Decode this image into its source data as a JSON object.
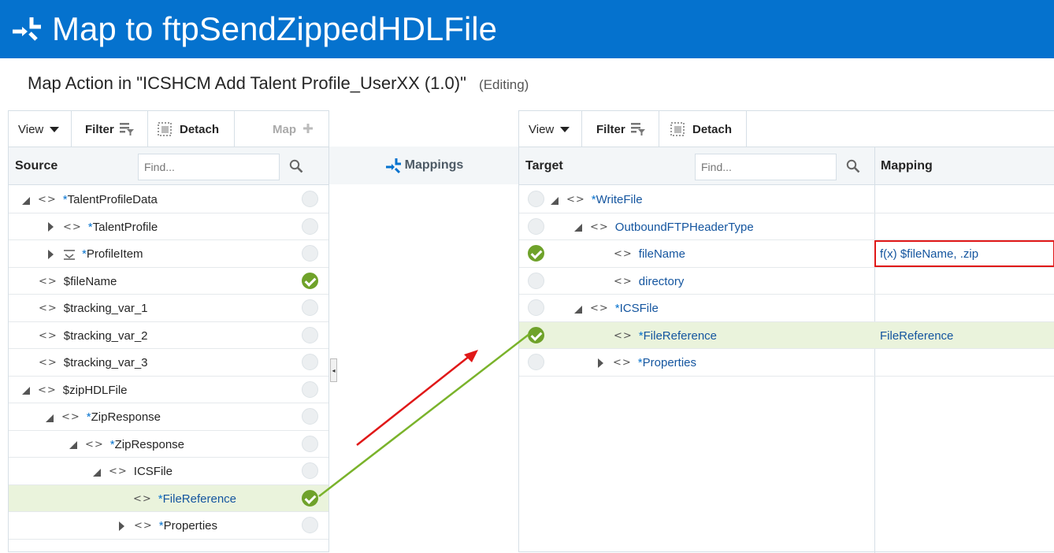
{
  "header": {
    "title": "Map to ftpSendZippedHDLFile",
    "icon": "map-merge-icon",
    "bg_color": "#0572ce"
  },
  "subheader": {
    "title": "Map Action in \"ICSHCM Add Talent Profile_UserXX (1.0)\"",
    "status": "(Editing)"
  },
  "source_panel": {
    "toolbar": {
      "view": "View",
      "filter": "Filter",
      "detach": "Detach",
      "map": "Map"
    },
    "column": "Source",
    "search_placeholder": "Find...",
    "rows": [
      {
        "star": "*",
        "label": "TalentProfileData"
      },
      {
        "star": "*",
        "label": "TalentProfile"
      },
      {
        "star": "*",
        "label": "ProfileItem"
      },
      {
        "star": "",
        "label": "$fileName"
      },
      {
        "star": "",
        "label": "$tracking_var_1"
      },
      {
        "star": "",
        "label": "$tracking_var_2"
      },
      {
        "star": "",
        "label": "$tracking_var_3"
      },
      {
        "star": "",
        "label": "$zipHDLFile"
      },
      {
        "star": "*",
        "label": "ZipResponse"
      },
      {
        "star": "*",
        "label": "ZipResponse"
      },
      {
        "star": "",
        "label": "ICSFile"
      },
      {
        "star": "*",
        "label": "FileReference"
      },
      {
        "star": "*",
        "label": "Properties"
      }
    ]
  },
  "middle": {
    "label": "Mappings",
    "icon": "mappings-icon"
  },
  "target_panel": {
    "toolbar": {
      "view": "View",
      "filter": "Filter",
      "detach": "Detach"
    },
    "column": "Target",
    "mapping_column": "Mapping",
    "search_placeholder": "Find...",
    "rows": [
      {
        "star": "*",
        "label": "WriteFile",
        "mapping": ""
      },
      {
        "star": "",
        "label": "OutboundFTPHeaderType",
        "mapping": ""
      },
      {
        "star": "",
        "label": "fileName",
        "mapping": "f(x) $fileName, .zip"
      },
      {
        "star": "",
        "label": "directory",
        "mapping": ""
      },
      {
        "star": "*",
        "label": "ICSFile",
        "mapping": ""
      },
      {
        "star": "*",
        "label": "FileReference",
        "mapping": "FileReference"
      },
      {
        "star": "*",
        "label": "Properties",
        "mapping": ""
      }
    ]
  },
  "colors": {
    "mapped_check": "#6fa22a",
    "highlight_row": "#eaf3dc",
    "annotation_red": "#e01818",
    "connector_green": "#7ab32b"
  }
}
